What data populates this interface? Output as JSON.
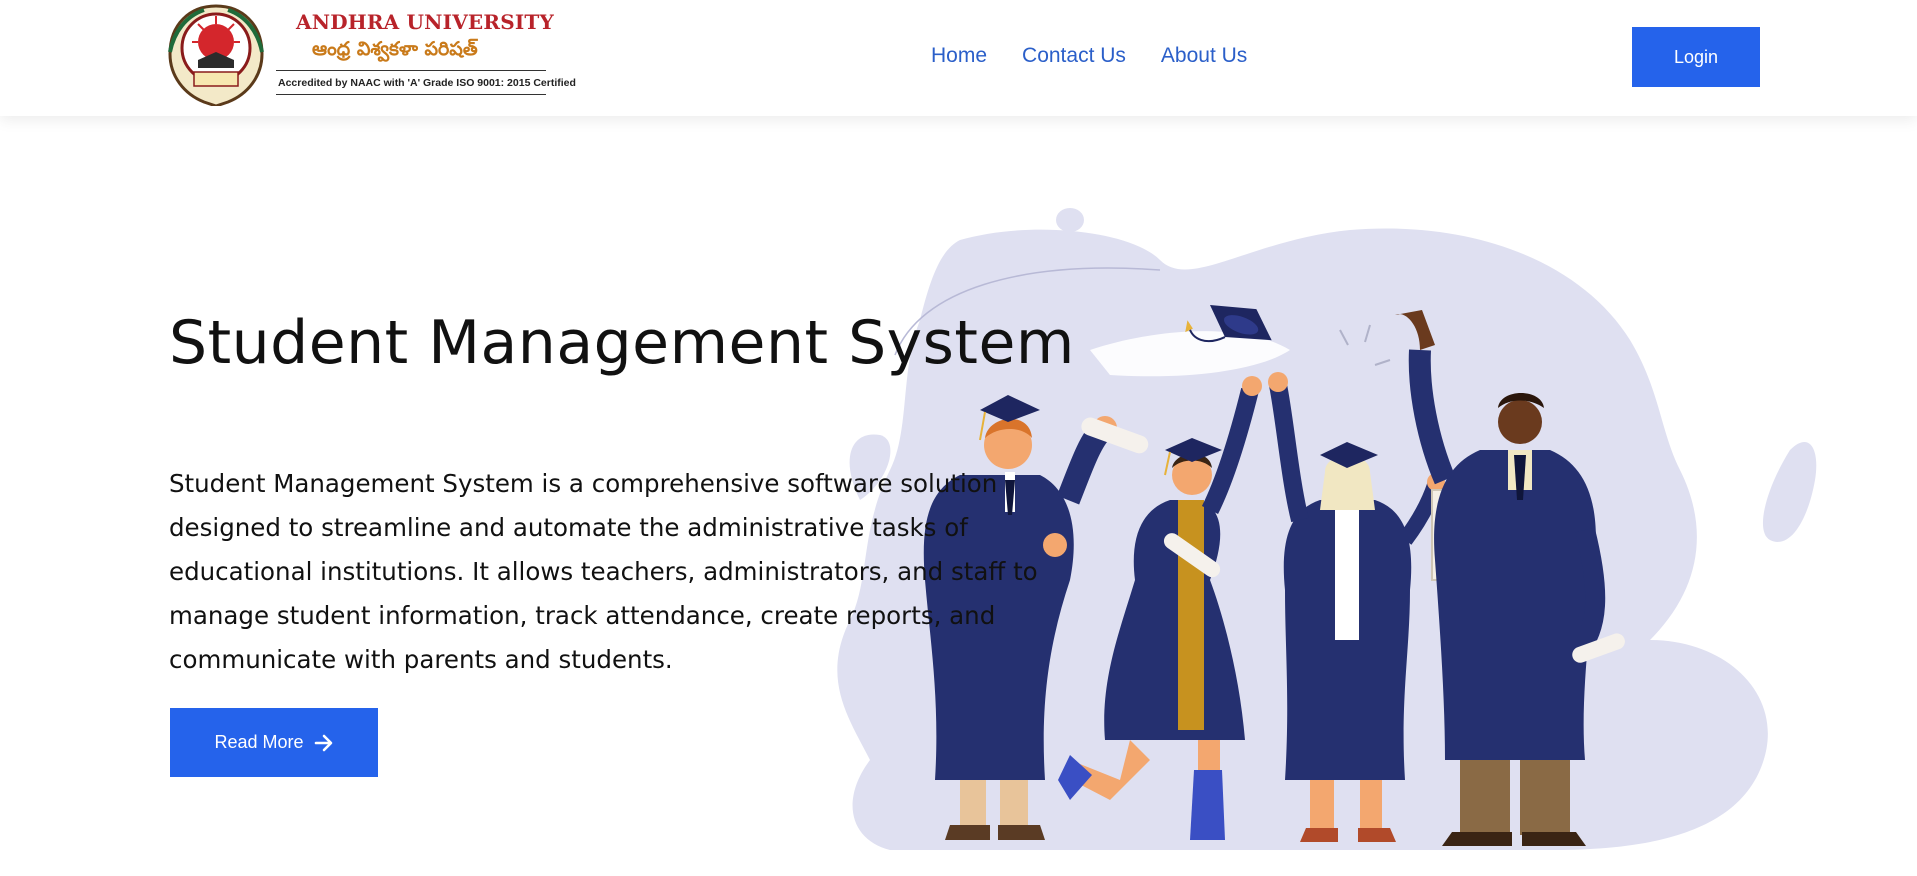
{
  "brand": {
    "name": "ANDHRA UNIVERSITY",
    "name_telugu": "ఆంధ్ర విశ్వకళా పరిషత్",
    "accreditation": "Accredited by NAAC with 'A' Grade ISO 9001: 2015 Certified",
    "primary_color": "#2563eb",
    "name_color": "#b8232a",
    "telugu_color": "#c97a1a"
  },
  "nav": {
    "items": [
      {
        "label": "Home"
      },
      {
        "label": "Contact Us"
      },
      {
        "label": "About Us"
      }
    ],
    "login_label": "Login"
  },
  "hero": {
    "title": "Student Management System",
    "description": "Student Management System is a comprehensive software solution designed to streamline and automate the administrative tasks of educational institutions. It allows teachers, administrators, and staff to manage student information, track attendance, create reports, and communicate with parents and students.",
    "button_label": "Read More",
    "button_icon": "arrow-right-icon",
    "illustration": "graduates-celebrating-illustration"
  }
}
